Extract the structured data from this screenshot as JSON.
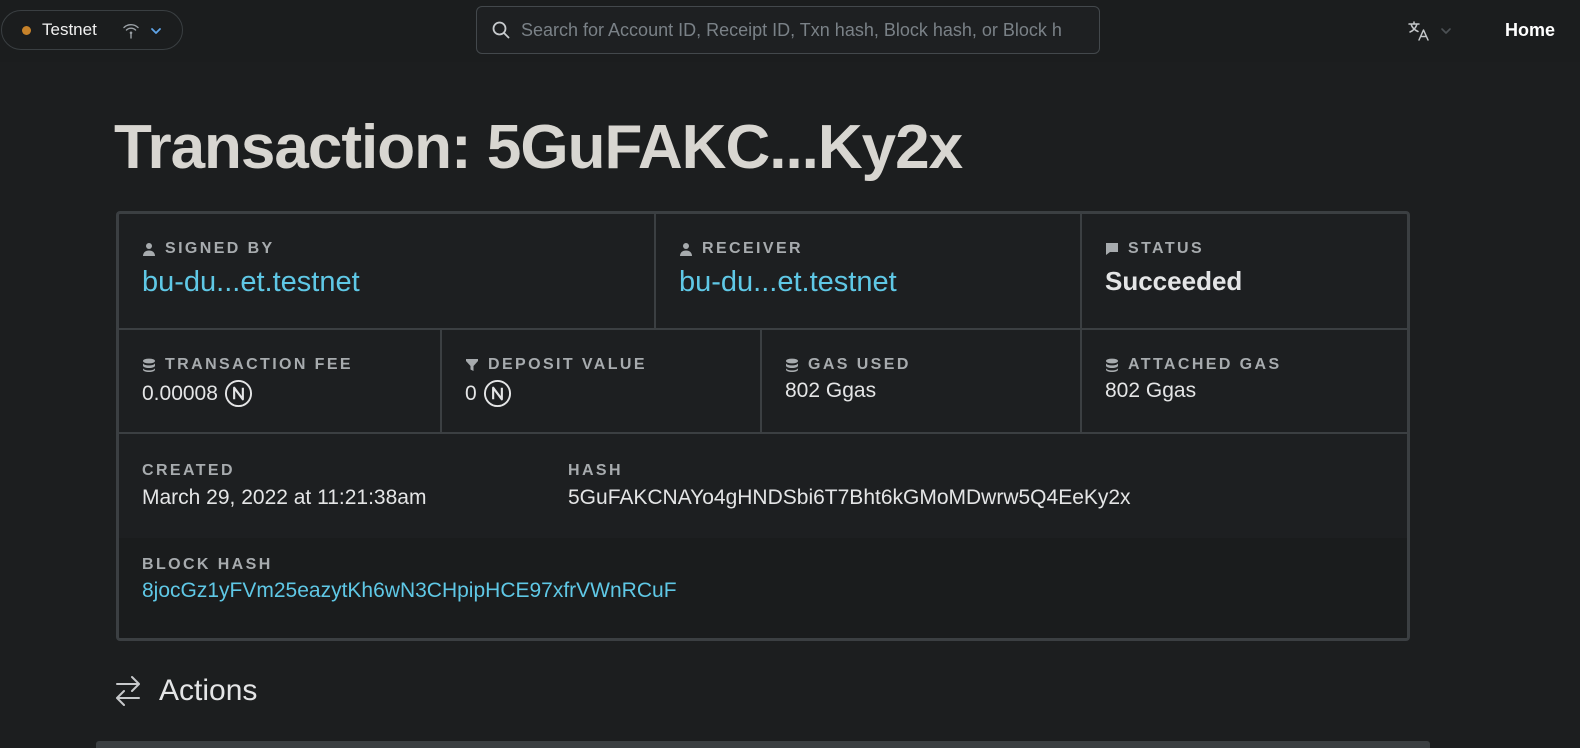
{
  "header": {
    "network": "Testnet",
    "search_placeholder": "Search for Account ID, Receipt ID, Txn hash, Block hash, or Block h",
    "home_label": "Home"
  },
  "page": {
    "title": "Transaction: 5GuFAKC...Ky2x"
  },
  "details": {
    "signed_by": {
      "label": "Signed by",
      "value": "bu-du...et.testnet"
    },
    "receiver": {
      "label": "Receiver",
      "value": "bu-du...et.testnet"
    },
    "status": {
      "label": "Status",
      "value": "Succeeded"
    },
    "transaction_fee": {
      "label": "Transaction fee",
      "value": "0.00008"
    },
    "deposit_value": {
      "label": "Deposit value",
      "value": "0"
    },
    "gas_used": {
      "label": "Gas used",
      "value": "802 Ggas"
    },
    "attached_gas": {
      "label": "Attached gas",
      "value": "802 Ggas"
    },
    "created": {
      "label": "Created",
      "value": "March 29, 2022 at 11:21:38am"
    },
    "hash": {
      "label": "Hash",
      "value": "5GuFAKCNAYo4gHNDSbi6T7Bht6kGMoMDwrw5Q4EeKy2x"
    },
    "block_hash": {
      "label": "Block hash",
      "value": "8jocGz1yFVm25eazytKh6wN3CHpipHCE97xfrVWnRCuF"
    }
  },
  "actions": {
    "title": "Actions"
  },
  "colors": {
    "background": "#1c1e1f",
    "link": "#5fc8e6",
    "network_dot": "#c6822a",
    "border": "#3b3f42"
  },
  "icons": {
    "network": "wifi-icon",
    "dropdown": "chevron-down-icon",
    "search": "search-icon",
    "language": "translate-icon",
    "account": "user-icon",
    "status": "comment-icon",
    "fee": "database-icon",
    "deposit": "filter-icon",
    "gas": "database-icon",
    "near": "near-token-icon",
    "actions": "arrows-exchange-icon"
  }
}
